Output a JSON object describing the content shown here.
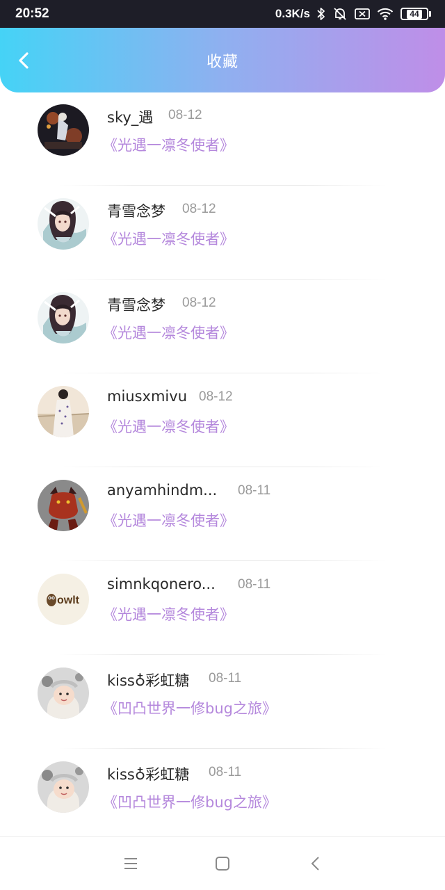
{
  "status_bar": {
    "time": "20:52",
    "net_speed": "0.3K/s",
    "battery": "44",
    "icons": [
      "bluetooth-icon",
      "mute-icon",
      "sim-off-icon",
      "wifi-icon",
      "battery-icon"
    ]
  },
  "header": {
    "title": "收藏",
    "back_icon": "chevron-left-icon"
  },
  "theme": {
    "gradient_start": "#45d3f6",
    "gradient_end": "#bf8ee8",
    "accent_title": "#b487dc",
    "date_gray": "#9a9a9a"
  },
  "items": [
    {
      "name": "sky_遇",
      "date": "08-12",
      "title": "《光遇一凛冬使者》"
    },
    {
      "name": "青雪念梦",
      "date": "08-12",
      "title": "《光遇一凛冬使者》"
    },
    {
      "name": "青雪念梦",
      "date": "08-12",
      "title": "《光遇一凛冬使者》"
    },
    {
      "name": "miusxmivu",
      "date": "08-12",
      "title": "《光遇一凛冬使者》"
    },
    {
      "name": "anyamhindm...",
      "date": "08-11",
      "title": "《光遇一凛冬使者》"
    },
    {
      "name": "simnkqonero...",
      "date": "08-11",
      "title": "《光遇一凛冬使者》"
    },
    {
      "name": "kiss♁彩虹糖",
      "date": "08-11",
      "title": "《凹凸世界一修bug之旅》"
    },
    {
      "name": "kiss♁彩虹糖",
      "date": "08-11",
      "title": "《凹凸世界一修bug之旅》"
    }
  ],
  "avatar_logo_text": "owlt",
  "nav": [
    "menu-icon",
    "home-icon",
    "back-icon"
  ]
}
